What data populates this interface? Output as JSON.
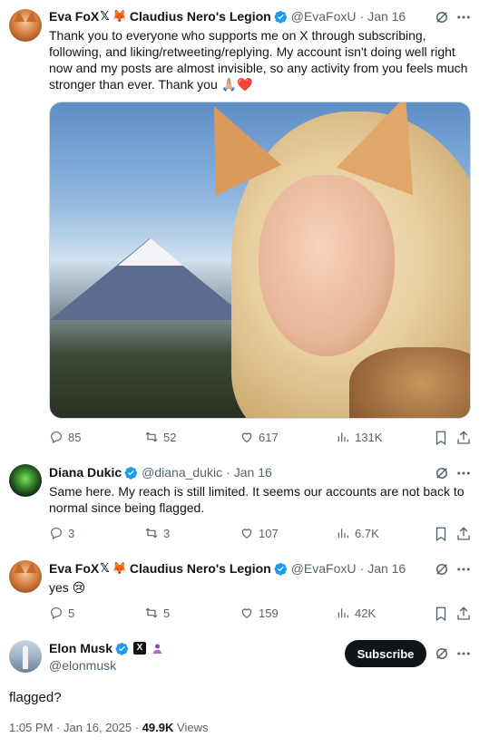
{
  "tweets": [
    {
      "name": "Eva FoX",
      "emoji_tail": "🦊",
      "community": "Claudius Nero's Legion",
      "handle": "@EvaFoxU",
      "date": "Jan 16",
      "text": "Thank you to everyone who supports me on X through subscribing, following, and liking/retweeting/replying. My account isn't doing well right now and my posts are almost invisible, so any activity from you feels much stronger than ever. Thank you 🙏🏼❤️",
      "replies": "85",
      "reposts": "52",
      "likes": "617",
      "views": "131K"
    },
    {
      "name": "Diana Dukic",
      "handle": "@diana_dukic",
      "date": "Jan 16",
      "text": "Same here. My reach is still limited. It seems our accounts are not back to normal since being flagged.",
      "replies": "3",
      "reposts": "3",
      "likes": "107",
      "views": "6.7K"
    },
    {
      "name": "Eva FoX",
      "emoji_tail": "🦊",
      "community": "Claudius Nero's Legion",
      "handle": "@EvaFoxU",
      "date": "Jan 16",
      "text": "yes 😢",
      "replies": "5",
      "reposts": "5",
      "likes": "159",
      "views": "42K"
    }
  ],
  "main_tweet": {
    "name": "Elon Musk",
    "handle": "@elonmusk",
    "subscribe_label": "Subscribe",
    "text": "flagged?",
    "time": "1:05 PM · Jan 16, 2025 · ",
    "views_count": "49.9K",
    "views_label": " Views"
  },
  "colors": {
    "verified": "#1d9bf0",
    "muted": "#536471",
    "text": "#0f1419"
  }
}
